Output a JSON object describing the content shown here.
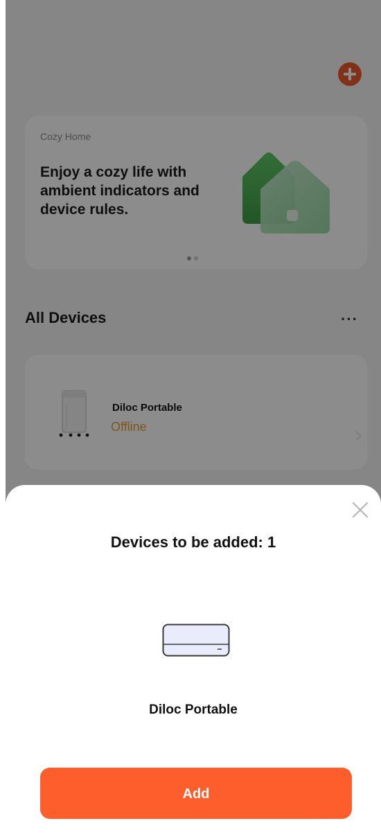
{
  "header": {
    "add_icon": "plus-circle-icon",
    "accent": "#ea5a2a"
  },
  "banner": {
    "label": "Cozy Home",
    "text": "Enjoy a cozy life with ambient indicators and device rules.",
    "pager_total": 2,
    "pager_active": 1
  },
  "devices": {
    "title": "All Devices",
    "more": "···",
    "items": [
      {
        "name": "Diloc Portable",
        "status": "Offline",
        "status_color": "#e79d2f"
      }
    ]
  },
  "sheet": {
    "title": "Devices to be added: 1",
    "device_name": "Diloc Portable",
    "add_label": "Add",
    "button_color": "#fe5d2c"
  }
}
